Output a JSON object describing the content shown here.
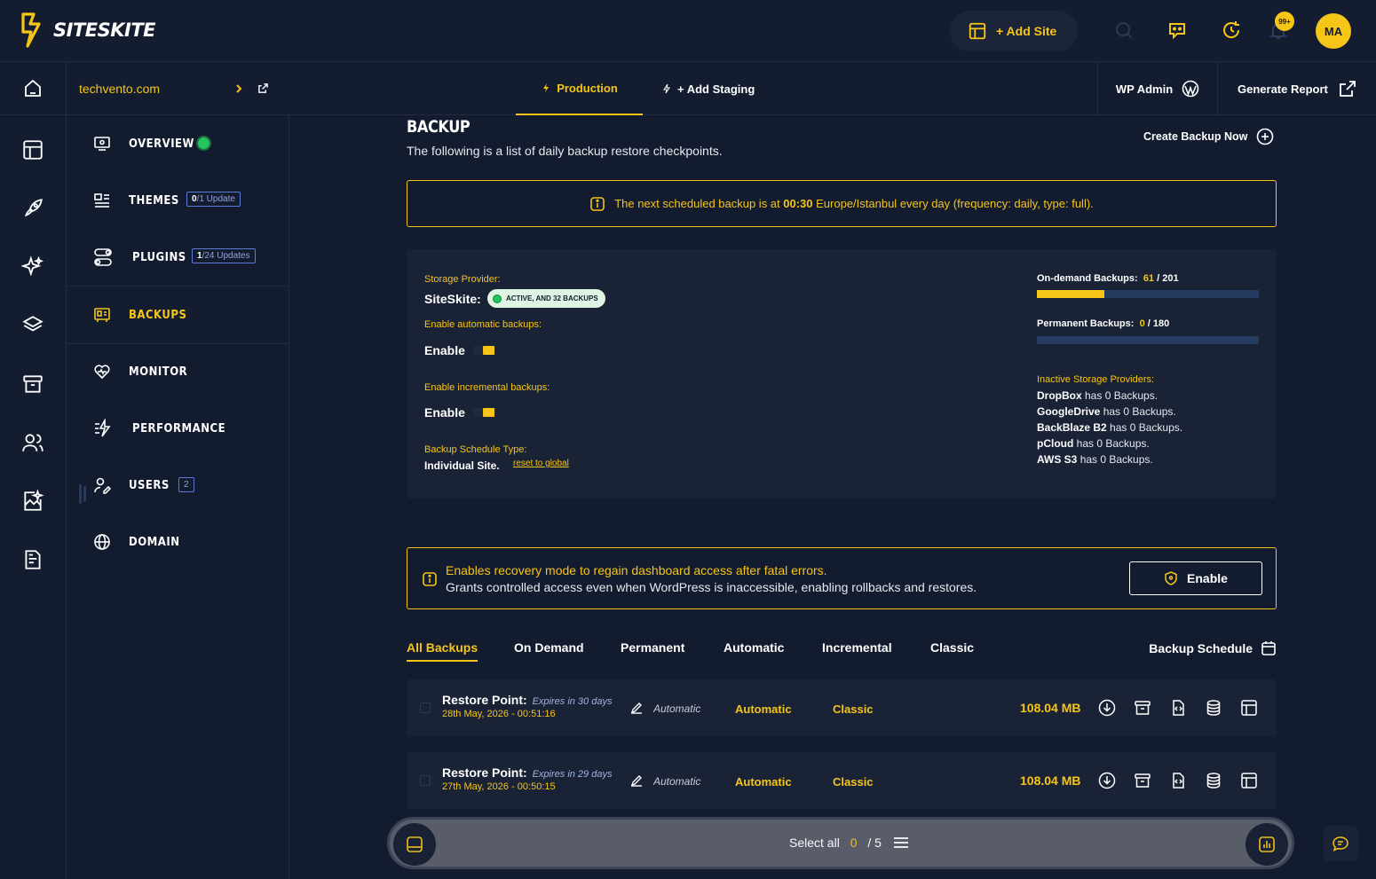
{
  "brand": {
    "name": "SITESKITE"
  },
  "topbar": {
    "add_site_label": "+ Add Site",
    "notifications_badge": "99+",
    "avatar_initials": "MA"
  },
  "subbar": {
    "site_name": "techvento.com",
    "tabs": [
      {
        "label": "Production",
        "active": true
      },
      {
        "label": "+ Add Staging",
        "active": false
      }
    ],
    "wp_admin_label": "WP Admin",
    "generate_report_label": "Generate Report"
  },
  "sidebar": {
    "items": [
      {
        "label": "OVERVIEW",
        "icon": "overview-icon"
      },
      {
        "label": "THEMES",
        "icon": "themes-icon",
        "badge_num": "0",
        "badge_text": "/1 Update"
      },
      {
        "label": "PLUGINS",
        "icon": "plugins-icon",
        "badge_num": "1",
        "badge_text": "/24 Updates"
      },
      {
        "label": "BACKUPS",
        "icon": "backups-icon",
        "active": true
      },
      {
        "label": "MONITOR",
        "icon": "monitor-heart-icon"
      },
      {
        "label": "PERFORMANCE",
        "icon": "performance-icon"
      },
      {
        "label": "USERS",
        "icon": "users-icon",
        "badge_text": "2"
      },
      {
        "label": "DOMAIN",
        "icon": "globe-icon"
      }
    ]
  },
  "backup": {
    "title": "BACKUP",
    "description": "The following is a list of daily backup restore checkpoints.",
    "create_label": "Create Backup Now",
    "schedule_notice_pre": "The next scheduled backup is at ",
    "schedule_notice_time": "00:30",
    "schedule_notice_post": " Europe/Istanbul every day (frequency: daily, type: full).",
    "storage_provider_label": "Storage Provider:",
    "storage_provider_value": "SiteSkite:",
    "storage_status": "ACTIVE, AND 32 BACKUPS",
    "auto_label": "Enable automatic backups:",
    "auto_value": "Enable",
    "incremental_label": "Enable incremental backups:",
    "incremental_value": "Enable",
    "schedule_type_label": "Backup Schedule Type:",
    "schedule_type_value": "Individual Site.",
    "reset_label": "reset to global",
    "ondemand_label": "On-demand Backups:",
    "ondemand_used": "61",
    "ondemand_total": "/ 201",
    "ondemand_fraction": 0.303,
    "permanent_label": "Permanent Backups:",
    "permanent_used": "0",
    "permanent_total": "/ 180",
    "permanent_fraction": 0,
    "inactive_label": "Inactive Storage Providers:",
    "inactive": [
      {
        "name": "DropBox",
        "text": " has 0 Backups."
      },
      {
        "name": "GoogleDrive",
        "text": " has 0 Backups."
      },
      {
        "name": "BackBlaze B2",
        "text": " has 0 Backups."
      },
      {
        "name": "pCloud",
        "text": " has 0 Backups."
      },
      {
        "name": "AWS S3",
        "text": " has 0 Backups."
      }
    ]
  },
  "recovery": {
    "line1": "Enables recovery mode to regain dashboard access after fatal errors.",
    "line2": "Grants controlled access even when WordPress is inaccessible, enabling rollbacks and restores.",
    "button": "Enable"
  },
  "backup_tabs": [
    "All Backups",
    "On Demand",
    "Permanent",
    "Automatic",
    "Incremental",
    "Classic"
  ],
  "backup_schedule_label": "Backup Schedule",
  "rows": [
    {
      "title": "Restore Point:",
      "expires": "Expires in 30 days",
      "date": "28th May, 2026 - 00:51:16",
      "note": "Automatic",
      "type": "Automatic",
      "method": "Classic",
      "size": "108.04 MB"
    },
    {
      "title": "Restore Point:",
      "expires": "Expires in 29 days",
      "date": "27th May, 2026 - 00:50:15",
      "note": "Automatic",
      "type": "Automatic",
      "method": "Classic",
      "size": "108.04 MB"
    }
  ],
  "floatbar": {
    "select_label": "Select all",
    "selected": "0",
    "total": "/ 5"
  },
  "colors": {
    "accent": "#f5c518",
    "bg": "#131b2e",
    "panel": "#1a2236",
    "badge": "#5b7bd5",
    "active": "#22c55e"
  }
}
